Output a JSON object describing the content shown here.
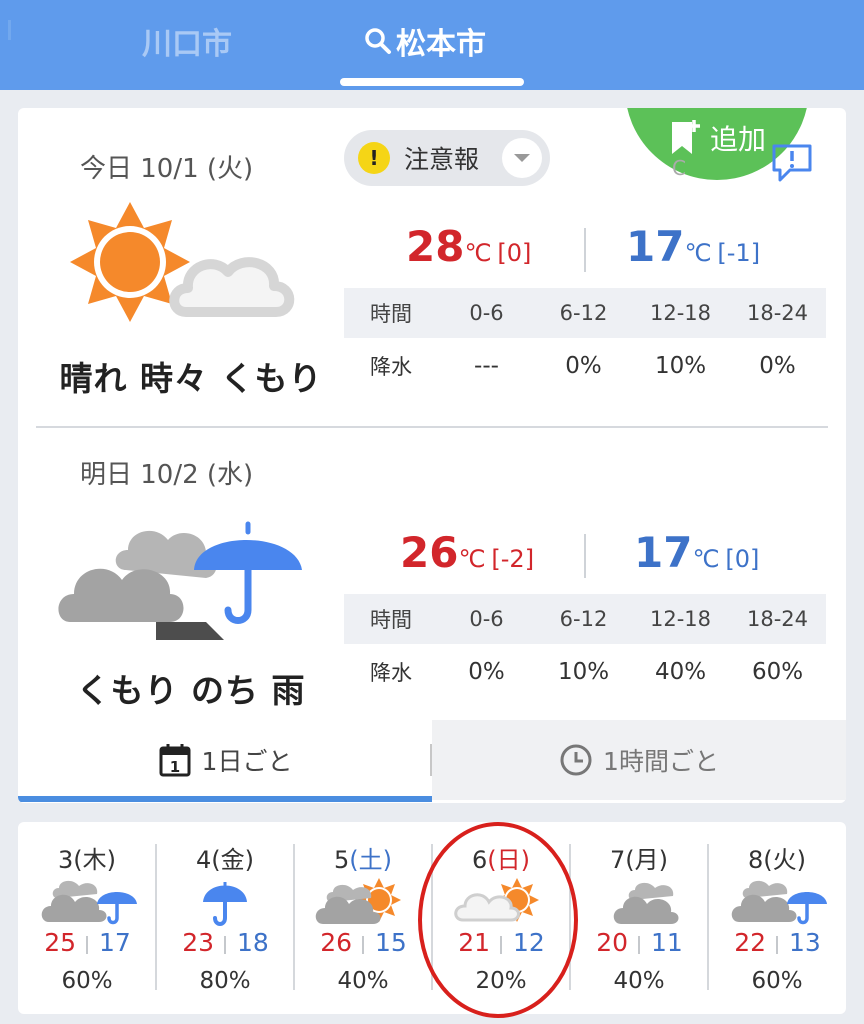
{
  "header": {
    "cities": [
      {
        "label": "川口市",
        "active": false
      },
      {
        "label": "松本市",
        "active": true
      }
    ]
  },
  "card": {
    "add_label": "追加",
    "partial_char": "C",
    "today": {
      "label": "今日 10/1 (火)",
      "alert_label": "注意報",
      "alert_symbol": "!",
      "weather_text": "晴れ 時々 くもり",
      "weather_icon": "sunny-then-cloudy-icon",
      "high": "28",
      "high_diff": "[0]",
      "low": "17",
      "low_diff": "[-1]",
      "unit": "℃",
      "precip_header": [
        "時間",
        "0-6",
        "6-12",
        "12-18",
        "18-24"
      ],
      "precip_values": [
        "降水",
        "---",
        "0%",
        "10%",
        "0%"
      ]
    },
    "tomorrow": {
      "label": "明日 10/2 (水)",
      "weather_text": "くもり のち 雨",
      "weather_icon": "cloudy-then-rain-icon",
      "high": "26",
      "high_diff": "[-2]",
      "low": "17",
      "low_diff": "[0]",
      "unit": "℃",
      "precip_header": [
        "時間",
        "0-6",
        "6-12",
        "12-18",
        "18-24"
      ],
      "precip_values": [
        "降水",
        "0%",
        "10%",
        "40%",
        "60%"
      ]
    },
    "view_tabs": {
      "daily": "1日ごと",
      "hourly": "1時間ごと",
      "calendar_day": "1"
    }
  },
  "weekly": [
    {
      "day": "3",
      "weekday": "(木)",
      "type": "weekday",
      "icon": "cloudy-rain-icon",
      "high": "25",
      "low": "17",
      "pop": "60%"
    },
    {
      "day": "4",
      "weekday": "(金)",
      "type": "weekday",
      "icon": "umbrella-icon",
      "high": "23",
      "low": "18",
      "pop": "80%"
    },
    {
      "day": "5",
      "weekday": "(土)",
      "type": "sat",
      "icon": "cloudy-sunny-icon",
      "high": "26",
      "low": "15",
      "pop": "40%"
    },
    {
      "day": "6",
      "weekday": "(日)",
      "type": "sun",
      "icon": "light-cloud-sunny-icon",
      "high": "21",
      "low": "12",
      "pop": "20%"
    },
    {
      "day": "7",
      "weekday": "(月)",
      "type": "weekday",
      "icon": "cloudy-icon",
      "high": "20",
      "low": "11",
      "pop": "40%"
    },
    {
      "day": "8",
      "weekday": "(火)",
      "type": "weekday",
      "icon": "cloudy-rain-icon",
      "high": "22",
      "low": "13",
      "pop": "60%"
    }
  ],
  "colors": {
    "header": "#5f9bec",
    "high_temp": "#d2262b",
    "low_temp": "#3d72c8",
    "add_button": "#5cc158",
    "sun": "#f5892b",
    "cloud": "#a3a3a3",
    "umbrella": "#4a86ee",
    "circle_annotation": "#d8201c"
  }
}
